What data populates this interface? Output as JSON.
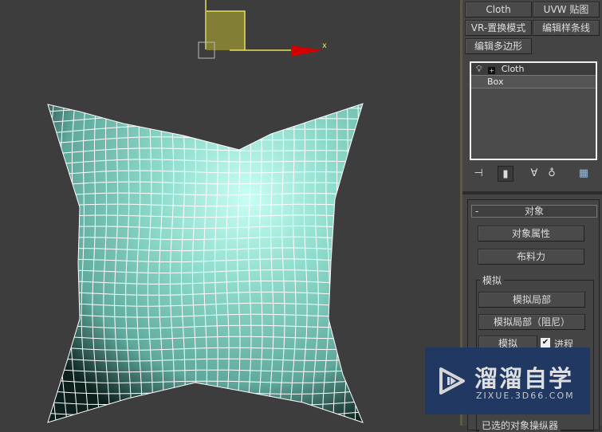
{
  "viewport": {
    "axis_label_x": "x",
    "mesh_color": "#7fd8c8",
    "wire_color": "#ffffff",
    "gizmo_color": "#e8e05a",
    "axis_x_color": "#d00000"
  },
  "modifiers": {
    "buttons": [
      "Cloth",
      "UVW 贴图",
      "VR-置换模式",
      "编辑样条线",
      "编辑多边形"
    ]
  },
  "stack": {
    "items": [
      {
        "label": "Cloth",
        "icon": "lightbulb-icon"
      },
      {
        "label": "Box"
      }
    ]
  },
  "stack_toolbar": [
    "pin-stack-icon",
    "show-end-result-icon",
    "make-unique-icon",
    "remove-modifier-icon",
    "configure-modifier-sets-icon"
  ],
  "rollout": {
    "collapse": "-",
    "title": "对象",
    "object_properties": "对象属性",
    "cloth_forces": "布料力",
    "simulation_group": "模拟",
    "simulate_local": "模拟局部",
    "simulate_local_damped": "模拟局部（阻尼）",
    "simulate": "模拟",
    "progress_label": "进程",
    "progress_checked": true,
    "next_group": "已选的对象操纵器"
  },
  "watermark": {
    "title": "溜溜自学",
    "url": "ZIXUE.3D66.COM"
  }
}
